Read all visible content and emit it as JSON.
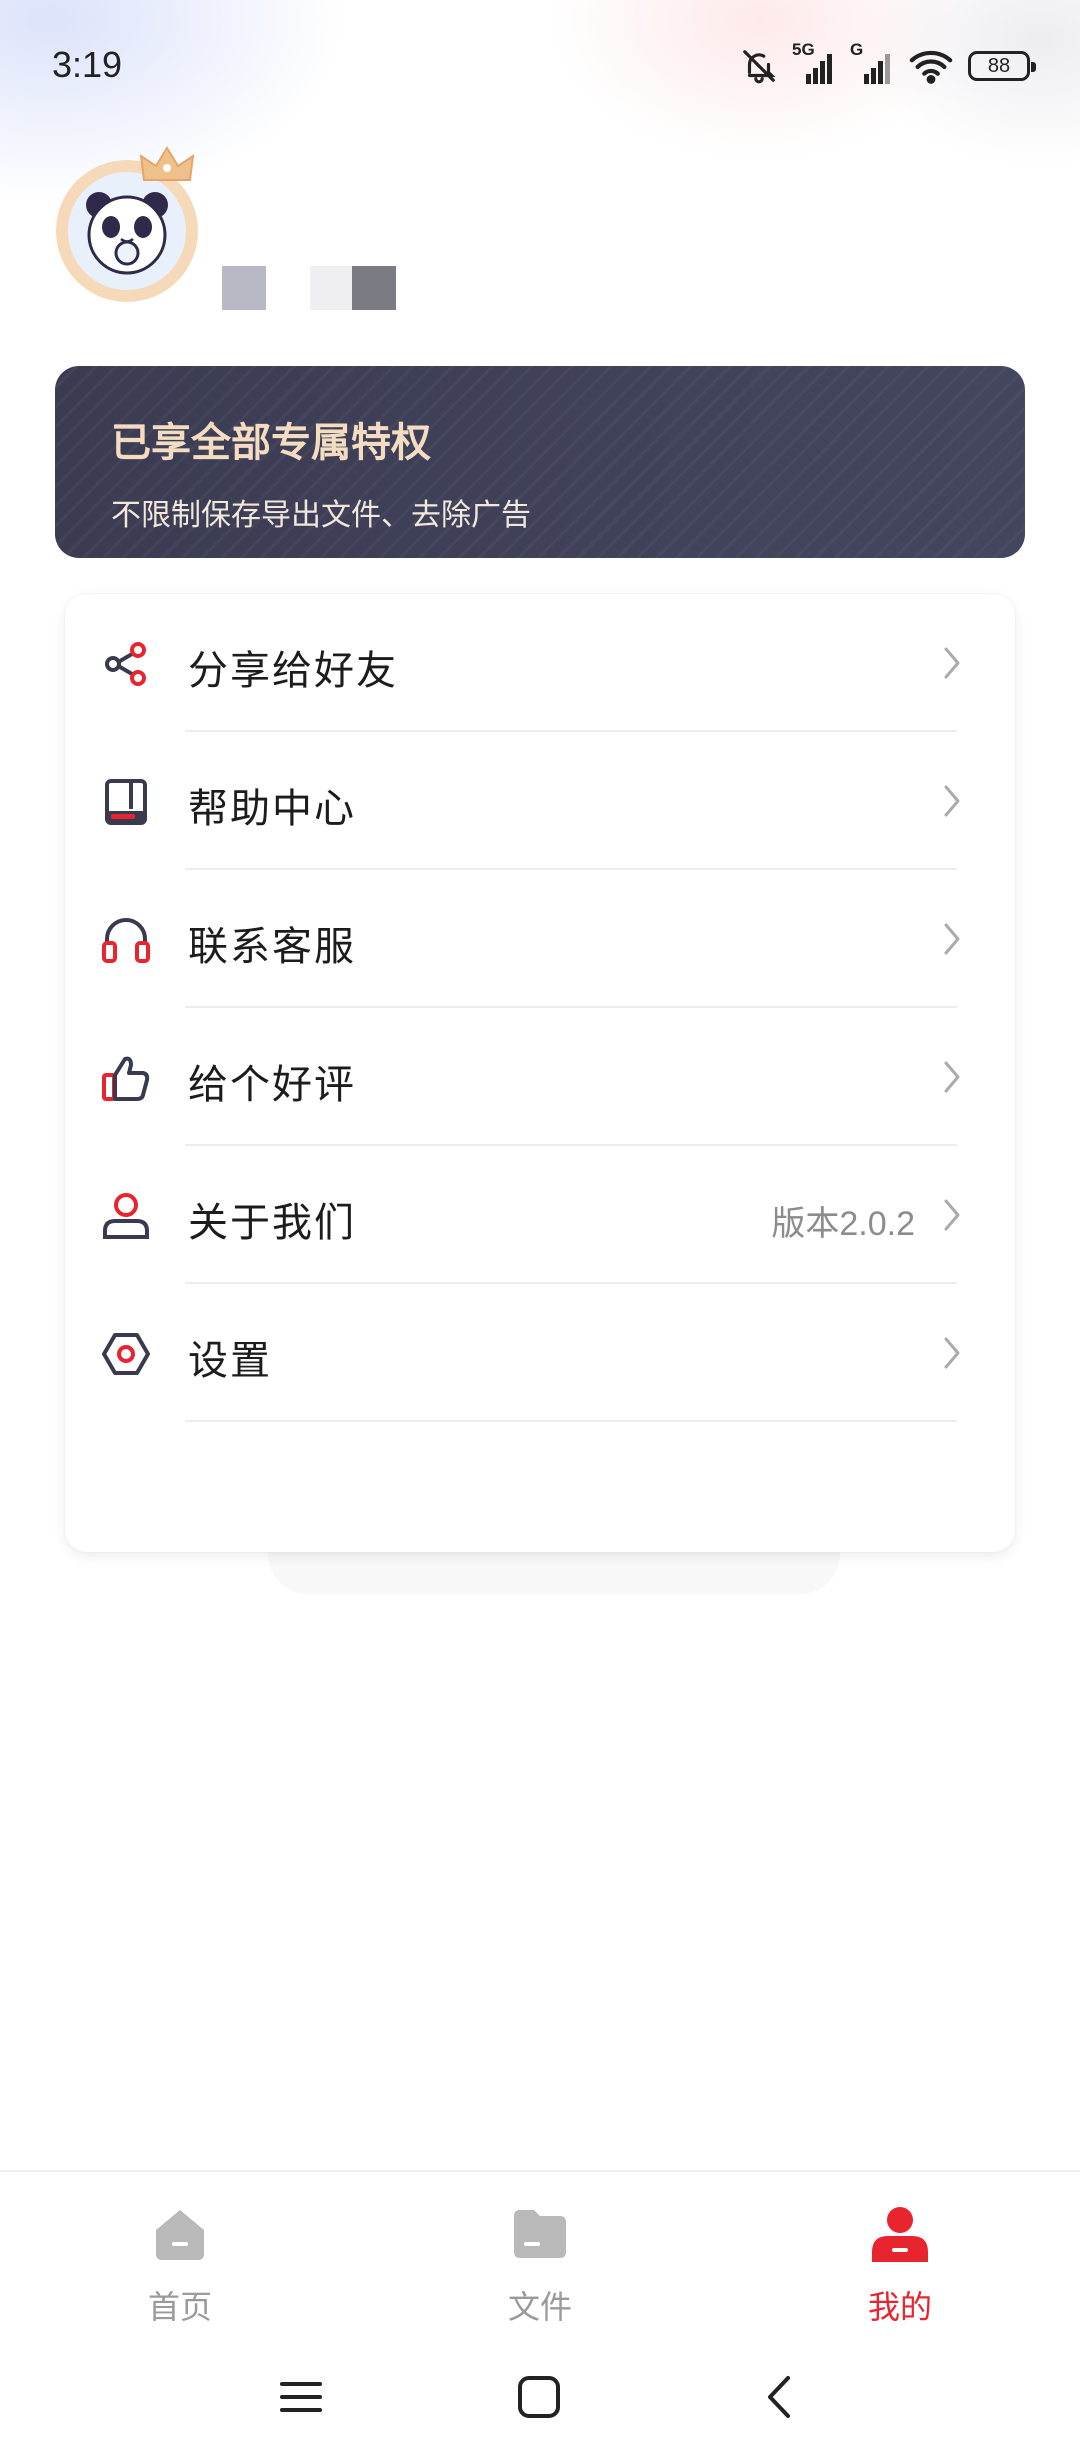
{
  "status_bar": {
    "time": "3:19",
    "network_1": "5G",
    "network_2": "G",
    "battery": "88"
  },
  "profile": {
    "avatar_icon": "panda-avatar-icon",
    "badge_icon": "crown-icon"
  },
  "vip_banner": {
    "title": "已享全部专属特权",
    "subtitle": "不限制保存导出文件、去除广告"
  },
  "menu": {
    "items": [
      {
        "label": "分享给好友",
        "icon": "share-icon",
        "extra": ""
      },
      {
        "label": "帮助中心",
        "icon": "book-icon",
        "extra": ""
      },
      {
        "label": "联系客服",
        "icon": "headphones-icon",
        "extra": ""
      },
      {
        "label": "给个好评",
        "icon": "thumbs-up-icon",
        "extra": ""
      },
      {
        "label": "关于我们",
        "icon": "person-icon",
        "extra": "版本2.0.2"
      },
      {
        "label": "设置",
        "icon": "settings-icon",
        "extra": ""
      }
    ]
  },
  "bottom_nav": {
    "items": [
      {
        "label": "首页",
        "icon": "home-icon",
        "active": false
      },
      {
        "label": "文件",
        "icon": "folder-icon",
        "active": false
      },
      {
        "label": "我的",
        "icon": "profile-icon",
        "active": true
      }
    ]
  },
  "colors": {
    "accent": "#e8242f",
    "icon_dark": "#3a3a4e",
    "banner_bg": "#3d3f55",
    "banner_title": "#f3dcc2"
  }
}
